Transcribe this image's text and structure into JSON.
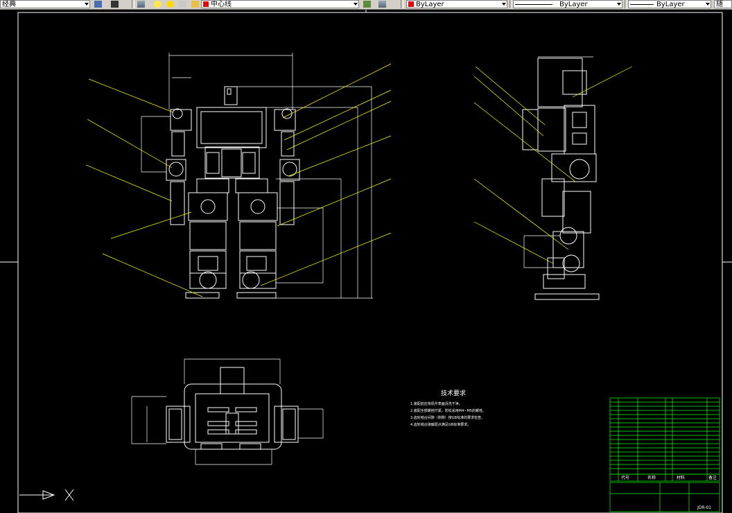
{
  "toolbar": {
    "workspace": "经典",
    "layer_name": "中心线",
    "color": "ByLayer",
    "linetype": "ByLayer",
    "lineweight": "ByLayer",
    "tail": "随"
  },
  "drawing": {
    "tech_title": "技术要求",
    "tech_notes": [
      "1.装配前应将机件表面清洗干净。",
      "2.装配全部螺栓拧紧，防松采用M4~M5的螺栓。",
      "3.齿轮啮合间隙（侧隙）按GB标准的要求检查。",
      "4.齿轮啮合接触斑点满足GB标准要求。"
    ],
    "title_block": {
      "code_label": "代号",
      "name_label": "名称",
      "material_label": "材料",
      "remark_label": "备注",
      "drawing_no": "JDR-01"
    }
  },
  "colors": {
    "background": "#000000",
    "lines": "#ffffff",
    "leaders": "#ffff00",
    "dimensions": "#ffff00",
    "title_block": "#00ff00",
    "toolbar": "#d4d0c8"
  },
  "icons": [
    "layers-icon",
    "lightbulb-icon",
    "sun-icon",
    "lock-icon",
    "color-square-icon",
    "ucs-icon"
  ]
}
